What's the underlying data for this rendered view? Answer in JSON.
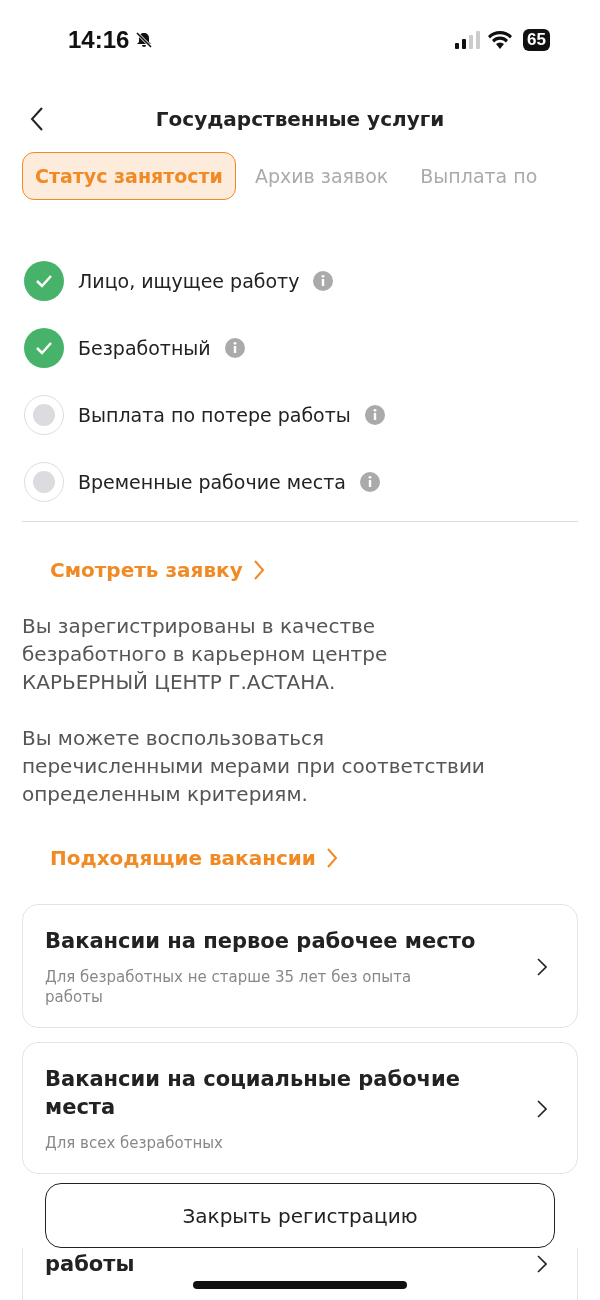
{
  "status_bar": {
    "time": "14:16",
    "battery": "65"
  },
  "header": {
    "title": "Государственные услуги"
  },
  "tabs": [
    {
      "label": "Статус занятости",
      "selected": true
    },
    {
      "label": "Архив заявок",
      "selected": false
    },
    {
      "label": "Выплата по",
      "selected": false
    }
  ],
  "statuses": [
    {
      "label": "Лицо, ищущее работу",
      "checked": true
    },
    {
      "label": "Безработный",
      "checked": true
    },
    {
      "label": "Выплата по потере работы",
      "checked": false
    },
    {
      "label": "Временные рабочие места",
      "checked": false
    }
  ],
  "view_link": "Смотреть заявку",
  "paragraphs": [
    "Вы зарегистрированы в качестве безработного в карьерном центре КАРЬЕРНЫЙ ЦЕНТР Г.АСТАНА.",
    "Вы можете воспользоваться перечисленными мерами при соответствии определенным критериям."
  ],
  "vacancies_link": "Подходящие вакансии",
  "cards": [
    {
      "title": "Вакансии на первое рабочее место",
      "subtitle": "Для безработных не старше 35 лет без опыта работы"
    },
    {
      "title": "Вакансии на социальные рабочие места",
      "subtitle": "Для всех безработных"
    },
    {
      "title": "работы",
      "partial": true
    }
  ],
  "close_button": "Закрыть регистрацию"
}
